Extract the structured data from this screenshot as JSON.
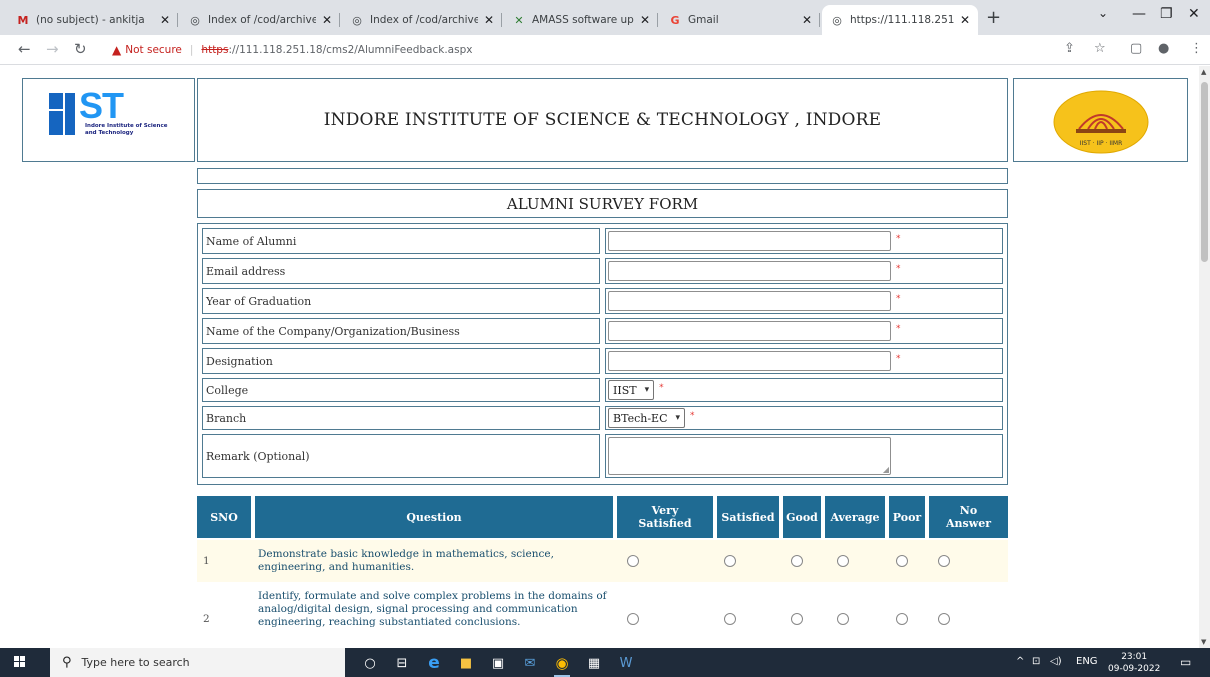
{
  "browser": {
    "tabs": [
      {
        "title": "(no subject) - ankitja",
        "icon": "gmail-icon",
        "glyph": "M",
        "color": "#c5221f"
      },
      {
        "title": "Index of /cod/archive",
        "icon": "globe-icon",
        "glyph": "◎",
        "color": "#5f6368"
      },
      {
        "title": "Index of /cod/archive",
        "icon": "globe-icon",
        "glyph": "◎",
        "color": "#5f6368"
      },
      {
        "title": "AMASS software upd",
        "icon": "amass-icon",
        "glyph": "✕",
        "color": "#2e7d32"
      },
      {
        "title": "Gmail",
        "icon": "google-icon",
        "glyph": "G",
        "color": "#ea4335"
      },
      {
        "title": "https://111.118.251.1",
        "icon": "globe-icon",
        "glyph": "◎",
        "color": "#5f6368"
      }
    ],
    "url_warning": "Not secure",
    "url_scheme": "https",
    "url_rest": "://111.118.251.18/cms2/AlumniFeedback.aspx"
  },
  "header": {
    "logo_text": "ST",
    "logo_subtitle": "Indore Institute of Science and Technology",
    "title": "INDORE INSTITUTE OF SCIENCE & TECHNOLOGY , INDORE",
    "seal_text": "IIST · IIP · IIMR"
  },
  "form": {
    "title": "ALUMNI SURVEY FORM",
    "required_mark": "*",
    "fields": {
      "name": {
        "label": "Name of Alumni",
        "value": ""
      },
      "email": {
        "label": "Email address",
        "value": ""
      },
      "year": {
        "label": "Year of Graduation",
        "value": ""
      },
      "company": {
        "label": "Name of the Company/Organization/Business",
        "value": ""
      },
      "designation": {
        "label": "Designation",
        "value": ""
      },
      "college": {
        "label": "College",
        "value": "IIST"
      },
      "branch": {
        "label": "Branch",
        "value": "BTech-EC"
      },
      "remark": {
        "label": "Remark (Optional)",
        "value": ""
      }
    }
  },
  "survey": {
    "headers": {
      "sno": "SNO",
      "question": "Question",
      "very_satisfied_1": "Very",
      "very_satisfied_2": "Satisfied",
      "satisfied": "Satisfied",
      "good": "Good",
      "average": "Average",
      "poor": "Poor",
      "no_answer_1": "No",
      "no_answer_2": "Answer"
    },
    "rows": [
      {
        "sno": "1",
        "question": "Demonstrate basic knowledge in mathematics, science, engineering, and humanities."
      },
      {
        "sno": "2",
        "question": "Identify, formulate and solve complex problems in the domains of analog/digital design, signal processing and communication engineering, reaching substantiated conclusions."
      }
    ]
  },
  "taskbar": {
    "search_placeholder": "Type here to search",
    "lang": "ENG",
    "time": "23:01",
    "date": "09-09-2022"
  }
}
